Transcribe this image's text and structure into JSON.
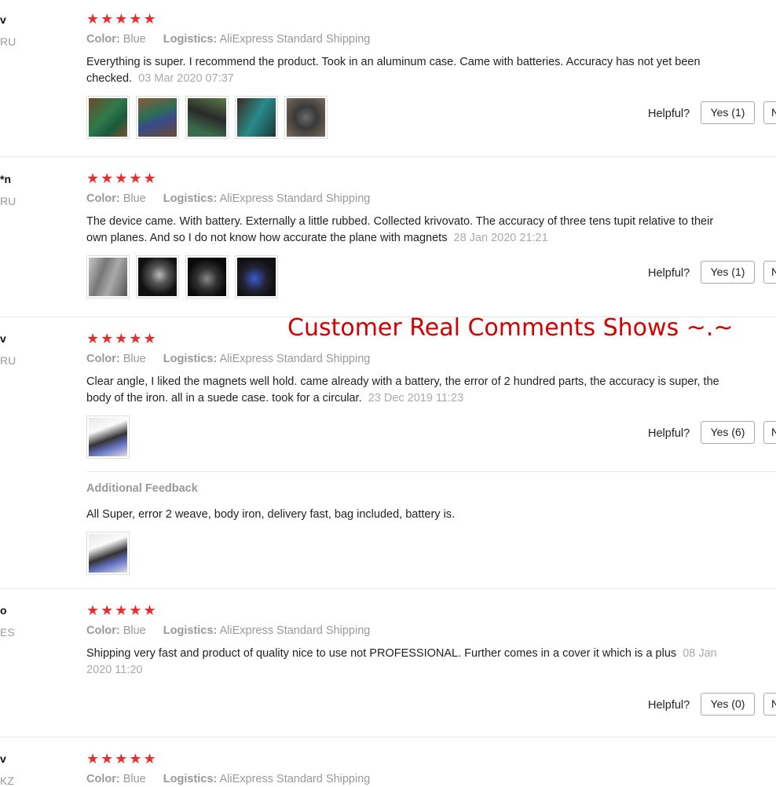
{
  "banner": "Customer Real Comments Shows ~.~",
  "labels": {
    "color_key": "Color:",
    "logistics_key": "Logistics:",
    "helpful": "Helpful?",
    "no_btn": "N",
    "additional_feedback": "Additional Feedback",
    "stars": "★★★★★"
  },
  "reviews": [
    {
      "name": "v",
      "country": "RU",
      "color": "Blue",
      "logistics": "AliExpress Standard Shipping",
      "text": "Everything is super. I recommend the product. Took in an aluminum case. Came with batteries. Accuracy has not yet been checked.",
      "date": "03 Mar 2020 07:37",
      "yes": "Yes (1)"
    },
    {
      "name": "*n",
      "country": "RU",
      "color": "Blue",
      "logistics": "AliExpress Standard Shipping",
      "text": "The device came. With battery. Externally a little rubbed. Collected krivovato. The accuracy of three tens tupit relative to their own planes. And so I do not know how accurate the plane with magnets",
      "date": "28 Jan 2020 21:21",
      "yes": "Yes (1)"
    },
    {
      "name": "v",
      "country": "RU",
      "color": "Blue",
      "logistics": "AliExpress Standard Shipping",
      "text": "Clear angle, I liked the magnets well hold. came already with a battery, the error of 2 hundred parts, the accuracy is super, the body of the iron. all in a suede case. took for a circular.",
      "date": "23 Dec 2019 11:23",
      "yes": "Yes (6)",
      "additional": "All Super, error 2 weave, body iron, delivery fast, bag included, battery is."
    },
    {
      "name": "o",
      "country": "ES",
      "color": "Blue",
      "logistics": "AliExpress Standard Shipping",
      "text": "Shipping very fast and product of quality nice to use not PROFESSIONAL. Further comes in a cover it which is a plus",
      "date": "08 Jan 2020 11:20",
      "yes": "Yes (0)"
    },
    {
      "name": "v",
      "country": "KZ",
      "color": "Blue",
      "logistics": "AliExpress Standard Shipping"
    }
  ]
}
